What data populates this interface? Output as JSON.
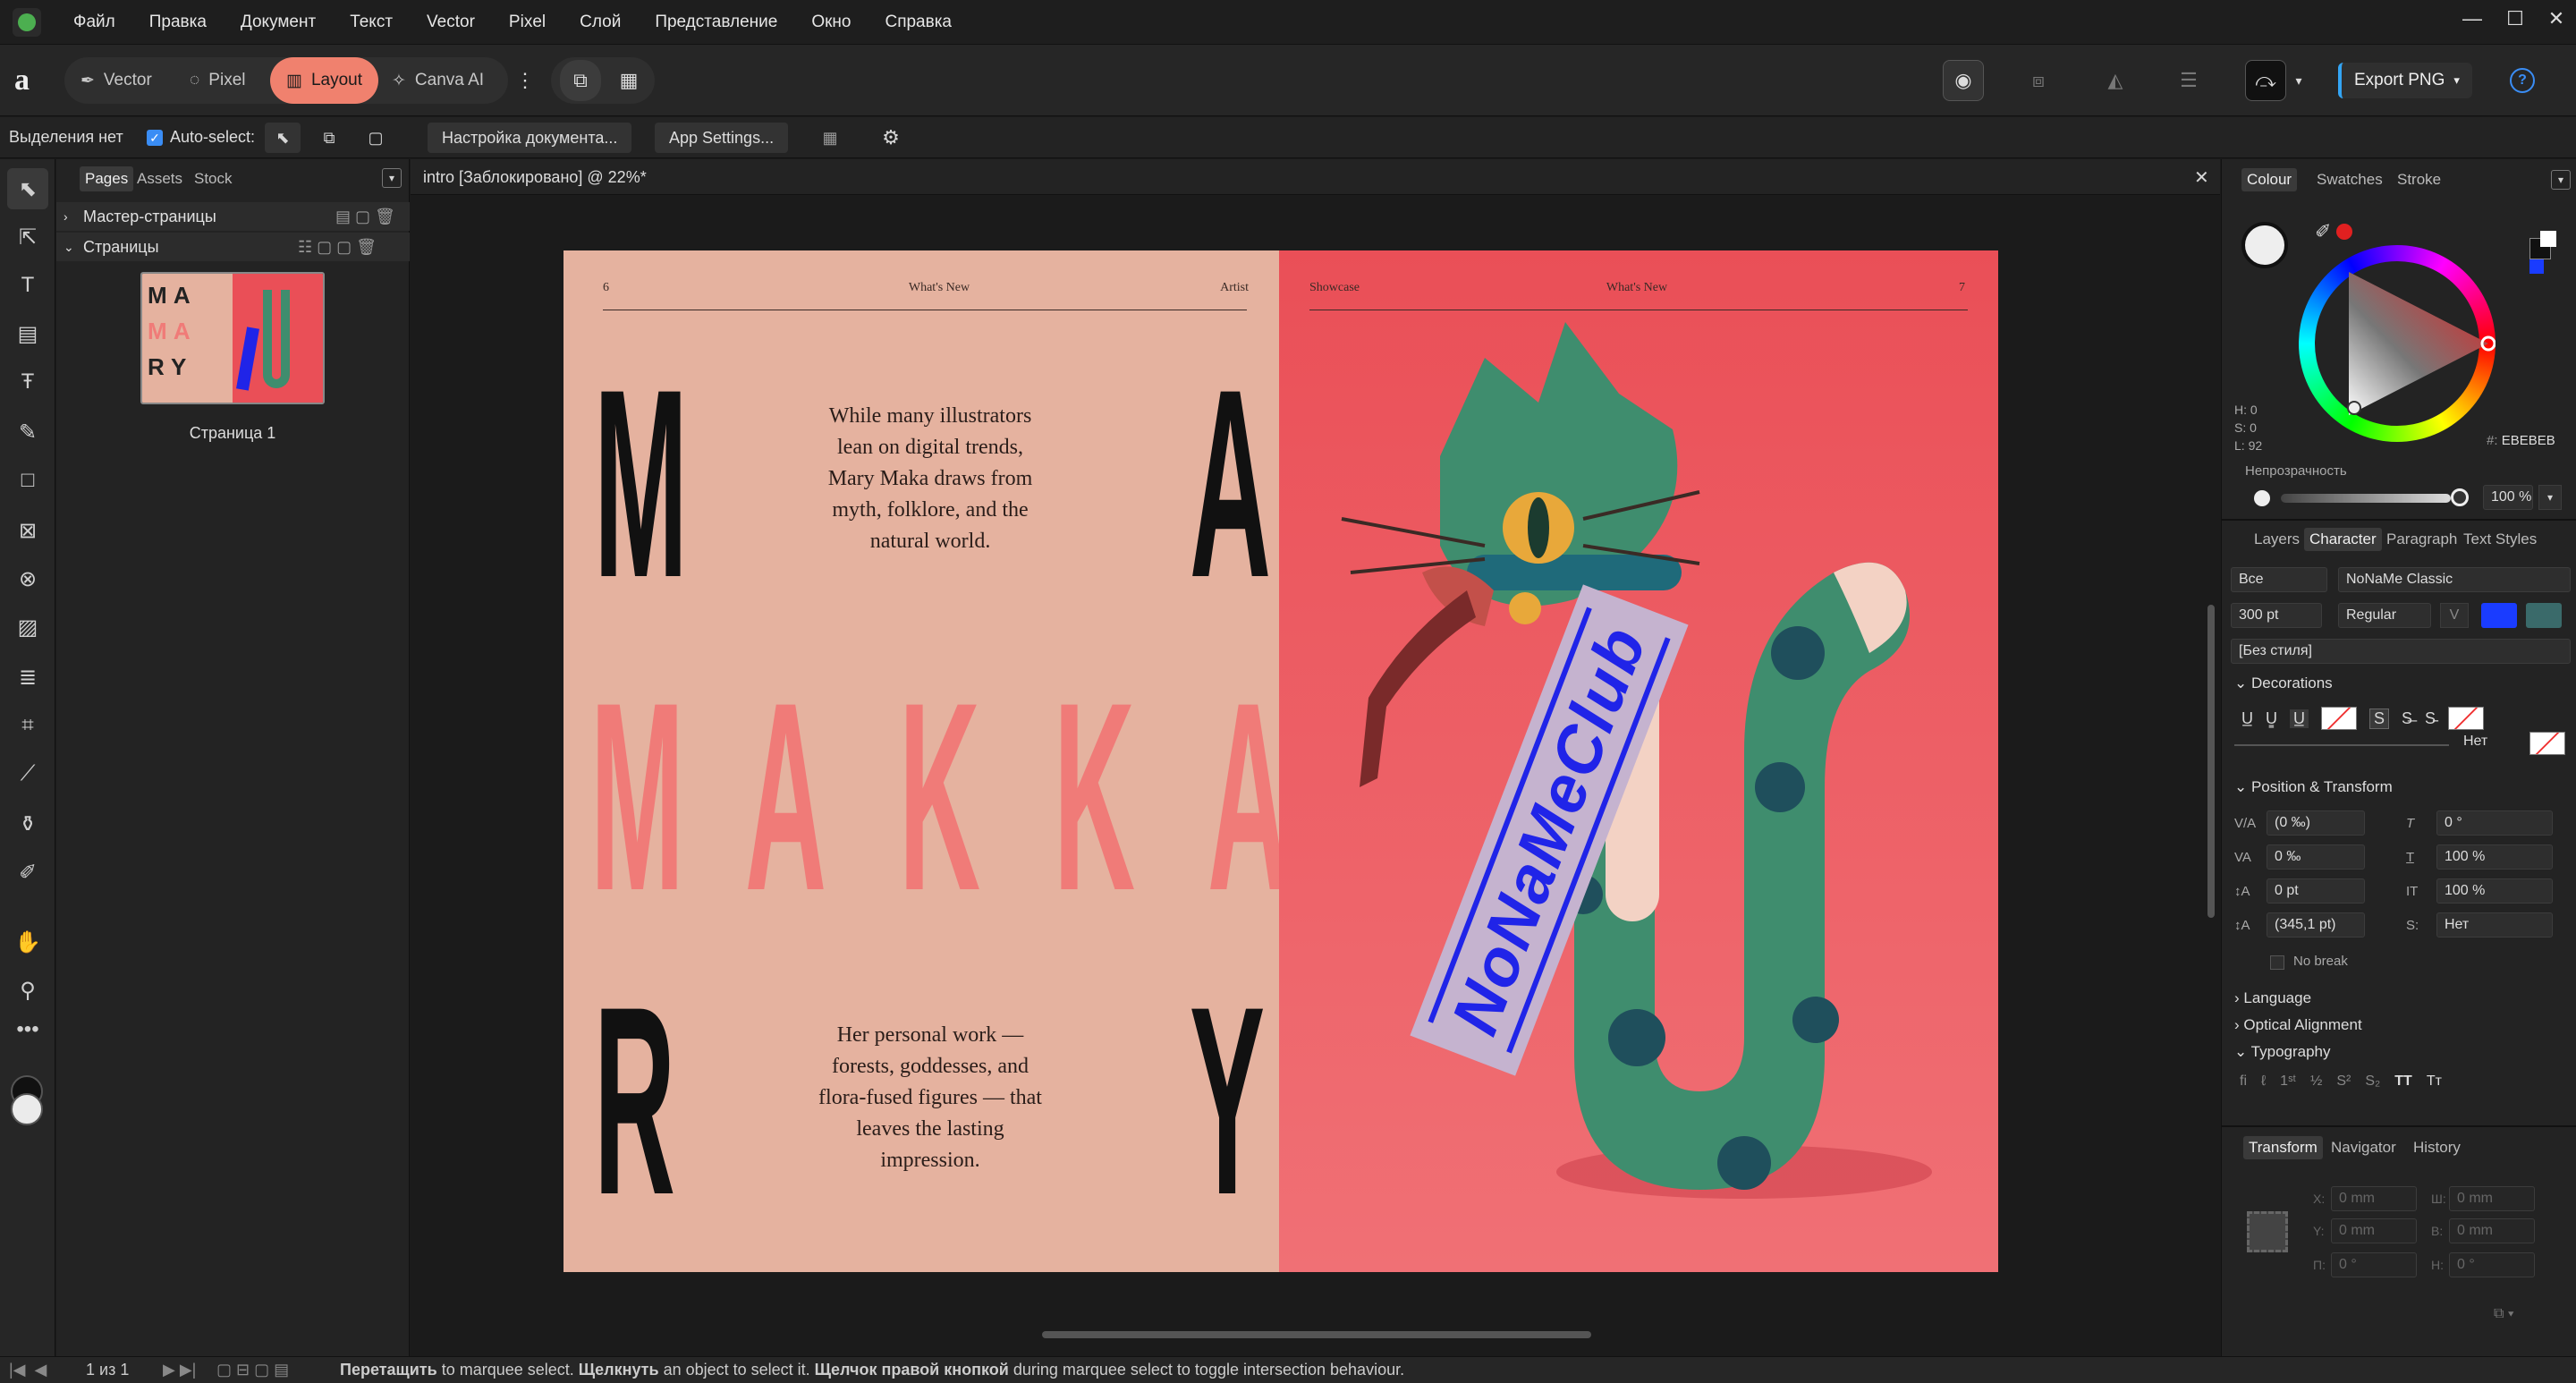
{
  "menubar": {
    "items": [
      "Файл",
      "Правка",
      "Документ",
      "Текст",
      "Vector",
      "Pixel",
      "Слой",
      "Представление",
      "Окно",
      "Справка"
    ],
    "window_controls": [
      "—",
      "☐",
      "✕"
    ]
  },
  "toolbar": {
    "personas": [
      {
        "label": "Vector",
        "icon": "vector-persona-icon"
      },
      {
        "label": "Pixel",
        "icon": "pixel-persona-icon"
      },
      {
        "label": "Layout",
        "icon": "layout-persona-icon",
        "active": true
      },
      {
        "label": "Canva AI",
        "icon": "canva-ai-icon"
      }
    ],
    "export_label": "Export PNG",
    "help": "?"
  },
  "contextbar": {
    "selection": "Выделения нет",
    "autoselect": "Auto-select:",
    "doc_setup": "Настройка документа...",
    "app_settings": "App Settings..."
  },
  "pages_panel": {
    "tabs": [
      "Pages",
      "Assets",
      "Stock"
    ],
    "masters": "Мастер-страницы",
    "pages": "Страницы",
    "page_label": "Страница 1"
  },
  "document": {
    "tab_title": "intro [Заблокировано] @ 22%*",
    "left_page": {
      "folio": "6",
      "section": "What's New",
      "tag": "Artist",
      "letters_top": [
        "M",
        "A"
      ],
      "letters_mid": "MAKKA",
      "letters_bottom": [
        "R",
        "Y"
      ],
      "body1": "While many illustrators lean on digital trends, Mary Maka draws from myth, folklore, and the natural world.",
      "body2": "Her personal work — forests, goddesses, and flora-fused figures — that leaves the lasting impression."
    },
    "right_page": {
      "tag": "Showcase",
      "section": "What's New",
      "folio": "7",
      "stamp": "NoNaMeClub"
    },
    "colors": {
      "left_bg": "#e5b29f",
      "right_bg": "#ea4f57",
      "pink_text": "#f07b78",
      "cat_green": "#3f8d6e",
      "stamp_blue": "#2024e8"
    }
  },
  "right_panel": {
    "colour_tabs": [
      "Colour",
      "Swatches",
      "Stroke"
    ],
    "hsl": [
      "H: 0",
      "S: 0",
      "L: 92"
    ],
    "hex": "EBEBEB",
    "opacity_label": "Непрозрачность",
    "opacity_value": "100 %",
    "char_tabs": [
      "Layers",
      "Character",
      "Paragraph",
      "Text Styles"
    ],
    "font_scope": "Все",
    "font_family": "NoNaMe Classic",
    "font_size": "300 pt",
    "font_weight": "Regular",
    "style": "[Без стиля]",
    "decorations": "Decorations",
    "deco_none": "Нет",
    "position_transform": "Position & Transform",
    "fields": {
      "kern": "(0 ‰)",
      "track": "0 ‰",
      "baseline": "0 pt",
      "leading": "(345,1 pt)",
      "skew": "0 °",
      "hscale": "100 %",
      "vscale": "100 %",
      "lang_none": "Нет"
    },
    "no_break": "No break",
    "language": "Language",
    "optical": "Optical Alignment",
    "typography": "Typography",
    "transform_tabs": [
      "Transform",
      "Navigator",
      "History"
    ],
    "transform": {
      "x": "0 mm",
      "y": "0 mm",
      "w": "0 mm",
      "h": "0 mm",
      "r": "0 °",
      "s": "0 °"
    },
    "transform_labels": {
      "x": "X:",
      "y": "Y:",
      "w": "Ш:",
      "h": "В:",
      "r": "П:",
      "s": "Н:"
    }
  },
  "status": {
    "page_counter": "1 из 1",
    "b1": "Перетащить",
    "t1": " to marquee select. ",
    "b2": "Щелкнуть",
    "t2": " an object to select it. ",
    "b3": "Щелчок правой кнопкой",
    "t3": " during marquee select to toggle intersection behaviour."
  }
}
